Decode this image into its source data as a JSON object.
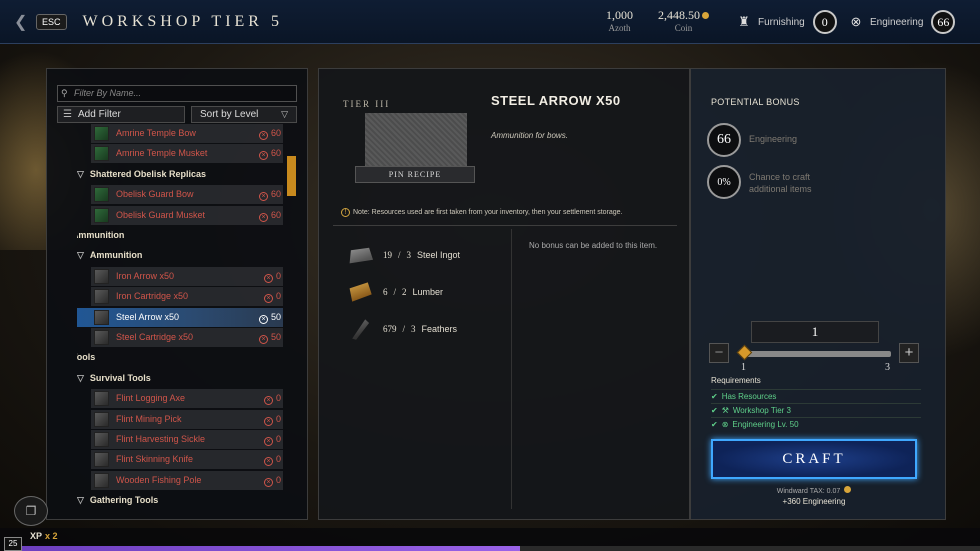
{
  "header": {
    "esc_label": "ESC",
    "title": "WORKSHOP TIER 5",
    "azoth_value": "1,000",
    "azoth_label": "Azoth",
    "coin_value": "2,448.50",
    "coin_label": "Coin",
    "furnishing_label": "Furnishing",
    "furnishing_level": "0",
    "engineering_label": "Engineering",
    "engineering_level": "66"
  },
  "sidebar": {
    "filter_placeholder": "Filter By Name...",
    "add_filter_label": "Add Filter",
    "sort_label": "Sort by Level",
    "scroll_position": 0.15,
    "rows": [
      {
        "kind": "recipe",
        "name": "Amrine Temple Bow",
        "qty": "60",
        "thumb": "green"
      },
      {
        "kind": "recipe",
        "name": "Amrine Temple Musket",
        "qty": "60",
        "thumb": "green"
      },
      {
        "kind": "subcat",
        "name": "Shattered Obelisk Replicas"
      },
      {
        "kind": "recipe",
        "name": "Obelisk Guard Bow",
        "qty": "60",
        "thumb": "green"
      },
      {
        "kind": "recipe",
        "name": "Obelisk Guard Musket",
        "qty": "60",
        "thumb": "green"
      },
      {
        "kind": "cat",
        "name": "Ammunition"
      },
      {
        "kind": "subcat",
        "name": "Ammunition"
      },
      {
        "kind": "recipe",
        "name": "Iron Arrow x50",
        "qty": "0",
        "thumb": "grey"
      },
      {
        "kind": "recipe",
        "name": "Iron Cartridge x50",
        "qty": "0",
        "thumb": "grey"
      },
      {
        "kind": "recipe",
        "name": "Steel Arrow x50",
        "qty": "50",
        "thumb": "grey",
        "selected": true
      },
      {
        "kind": "recipe",
        "name": "Steel Cartridge x50",
        "qty": "50",
        "thumb": "grey"
      },
      {
        "kind": "cat",
        "name": "Tools"
      },
      {
        "kind": "subcat",
        "name": "Survival Tools"
      },
      {
        "kind": "recipe",
        "name": "Flint Logging Axe",
        "qty": "0",
        "thumb": "grey"
      },
      {
        "kind": "recipe",
        "name": "Flint Mining Pick",
        "qty": "0",
        "thumb": "grey"
      },
      {
        "kind": "recipe",
        "name": "Flint Harvesting Sickle",
        "qty": "0",
        "thumb": "grey"
      },
      {
        "kind": "recipe",
        "name": "Flint Skinning Knife",
        "qty": "0",
        "thumb": "grey"
      },
      {
        "kind": "recipe",
        "name": "Wooden Fishing Pole",
        "qty": "0",
        "thumb": "grey"
      },
      {
        "kind": "subcat",
        "name": "Gathering Tools"
      }
    ]
  },
  "detail": {
    "tier_label": "TIER III",
    "pin_label": "PIN RECIPE",
    "title": "STEEL ARROW X50",
    "description": "Ammunition for bows.",
    "note": "Note: Resources used are first taken from your inventory, then your settlement storage.",
    "no_bonus": "No bonus can be added to this item.",
    "resources": [
      {
        "have": "19",
        "need": "3",
        "name": "Steel Ingot",
        "icon": "ingot-icon"
      },
      {
        "have": "6",
        "need": "2",
        "name": "Lumber",
        "icon": "lumber-icon"
      },
      {
        "have": "679",
        "need": "3",
        "name": "Feathers",
        "icon": "feather-icon"
      }
    ]
  },
  "bonus": {
    "title": "POTENTIAL BONUS",
    "engineering_value": "66",
    "engineering_label": "Engineering",
    "chance_value": "0%",
    "chance_label_line1": "Chance to craft",
    "chance_label_line2": "additional items"
  },
  "craft": {
    "quantity": "1",
    "slider_min": "1",
    "slider_max": "3",
    "slider_value": 1,
    "requirements_title": "Requirements",
    "requirements": [
      "Has Resources",
      "Workshop Tier 3",
      "Engineering Lv. 50"
    ],
    "craft_label": "CRAFT",
    "tax_label": "Windward TAX: 0.07",
    "xp_label": "+360 Engineering"
  },
  "footer": {
    "xp_label": "XP",
    "xp_multiplier": "x 2",
    "level": "25",
    "xp_progress": 0.52
  }
}
